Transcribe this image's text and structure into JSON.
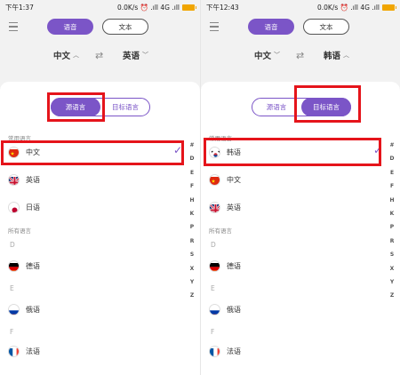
{
  "colors": {
    "accent": "#7b55c7",
    "highlight": "#e5141b"
  },
  "screens": [
    {
      "status_time": "下午1:37",
      "status_right": "0.0K/s ⏰ .ıll 4G .ıll",
      "toolbar": {
        "voice_label": "语音",
        "text_label": "文本"
      },
      "source_lang": "中文",
      "target_lang": "英语",
      "sheet": {
        "source_tab": "源语言",
        "target_tab": "目标语言",
        "active_tab": "source",
        "common_header": "常用语言",
        "all_header": "所有语言",
        "common": [
          {
            "flag": "cn",
            "name": "中文",
            "selected": true
          },
          {
            "flag": "gb",
            "name": "英语",
            "selected": false
          },
          {
            "flag": "jp",
            "name": "日语",
            "selected": false
          }
        ],
        "all": [
          {
            "letter": "D",
            "flag": "de",
            "name": "德语"
          },
          {
            "letter": "E",
            "flag": "ru",
            "name": "俄语"
          },
          {
            "letter": "F",
            "flag": "fr",
            "name": "法语"
          }
        ]
      }
    },
    {
      "status_time": "下午12:43",
      "status_right": "0.0K/s ⏰ .ıll 4G .ıll",
      "toolbar": {
        "voice_label": "语音",
        "text_label": "文本"
      },
      "source_lang": "中文",
      "target_lang": "韩语",
      "sheet": {
        "source_tab": "源语言",
        "target_tab": "目标语言",
        "active_tab": "target",
        "common_header": "常用语言",
        "all_header": "所有语言",
        "common": [
          {
            "flag": "kr",
            "name": "韩语",
            "selected": true
          },
          {
            "flag": "cn",
            "name": "中文",
            "selected": false
          },
          {
            "flag": "gb",
            "name": "英语",
            "selected": false
          }
        ],
        "all": [
          {
            "letter": "D",
            "flag": "de",
            "name": "德语"
          },
          {
            "letter": "E",
            "flag": "ru",
            "name": "俄语"
          },
          {
            "letter": "F",
            "flag": "fr",
            "name": "法语"
          }
        ]
      }
    }
  ],
  "index_letters": [
    "#",
    "D",
    "E",
    "F",
    "H",
    "K",
    "P",
    "R",
    "S",
    "X",
    "Y",
    "Z"
  ]
}
